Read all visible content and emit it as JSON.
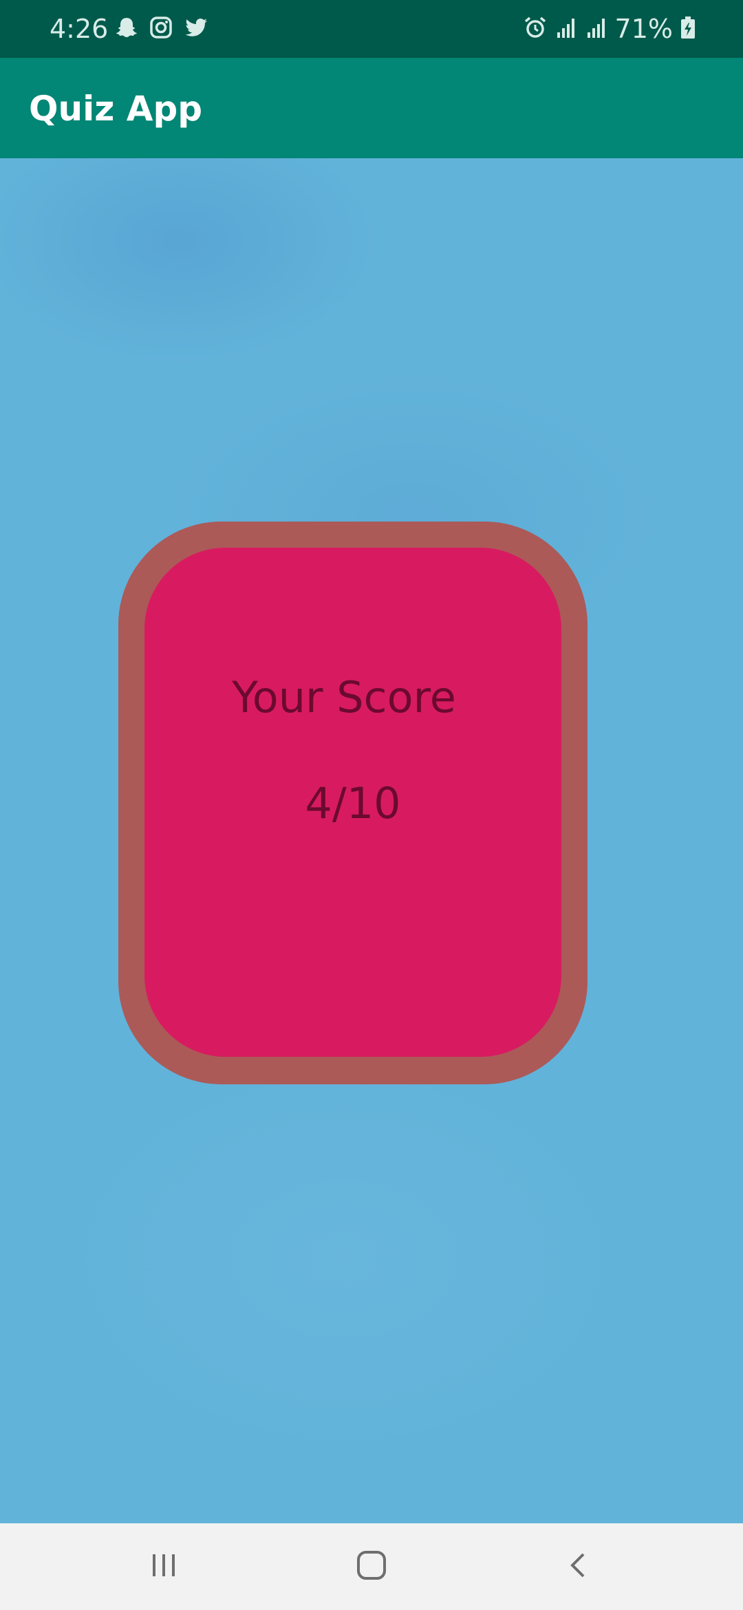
{
  "status_bar": {
    "time": "4:26",
    "left_icons": [
      "snapchat-icon",
      "instagram-icon",
      "twitter-icon"
    ],
    "right_icons": [
      "alarm-icon",
      "signal-icon",
      "signal-icon",
      "battery-charging-icon"
    ],
    "battery": "71%"
  },
  "app_bar": {
    "title": "Quiz App",
    "color": "#028675"
  },
  "score_card": {
    "label": "Your Score",
    "value": "4/10",
    "fill_color": "#d81b60",
    "border_color": "#ab5a58"
  },
  "nav_bar": {
    "buttons": [
      "recent-apps-icon",
      "home-icon",
      "back-icon"
    ]
  },
  "colors": {
    "status_bar": "#005a4b",
    "background": "#62b3da"
  }
}
